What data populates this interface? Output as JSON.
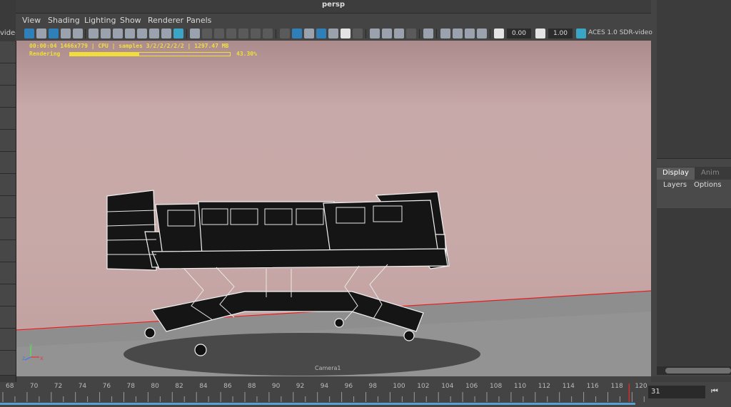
{
  "left_panel": {
    "label": "videc"
  },
  "viewport": {
    "title": "persp",
    "menu": [
      "View",
      "Shading",
      "Lighting",
      "Show",
      "Renderer",
      "Panels"
    ],
    "toolbar": {
      "exposure": "0.00",
      "gamma": "1.00",
      "color_space": "ACES 1.0 SDR-video"
    },
    "render_stats": "00:00:04 1466x779 | CPU | samples 3/2/2/2/2/2 | 1297.47 MB",
    "render_label": "Rendering",
    "render_progress_percent": 43.3,
    "render_progress_text": "43.30%",
    "camera_label": "Camera1",
    "axis_labels": {
      "x": "x",
      "y": "y",
      "z": "z"
    }
  },
  "right_panel": {
    "tabs": [
      "Display",
      "Anim"
    ],
    "menu": [
      "Layers",
      "Options"
    ]
  },
  "timeline": {
    "ticks": [
      68,
      70,
      72,
      74,
      76,
      78,
      80,
      82,
      84,
      86,
      88,
      90,
      92,
      94,
      96,
      98,
      100,
      102,
      104,
      106,
      108,
      110,
      112,
      114,
      116,
      118,
      120
    ],
    "current_frame": "31",
    "playhead_color": "#d03030"
  },
  "colors": {
    "hud_yellow": "#f0df3a",
    "accent_blue": "#2f7fb8",
    "horizon_red": "#e02020"
  }
}
